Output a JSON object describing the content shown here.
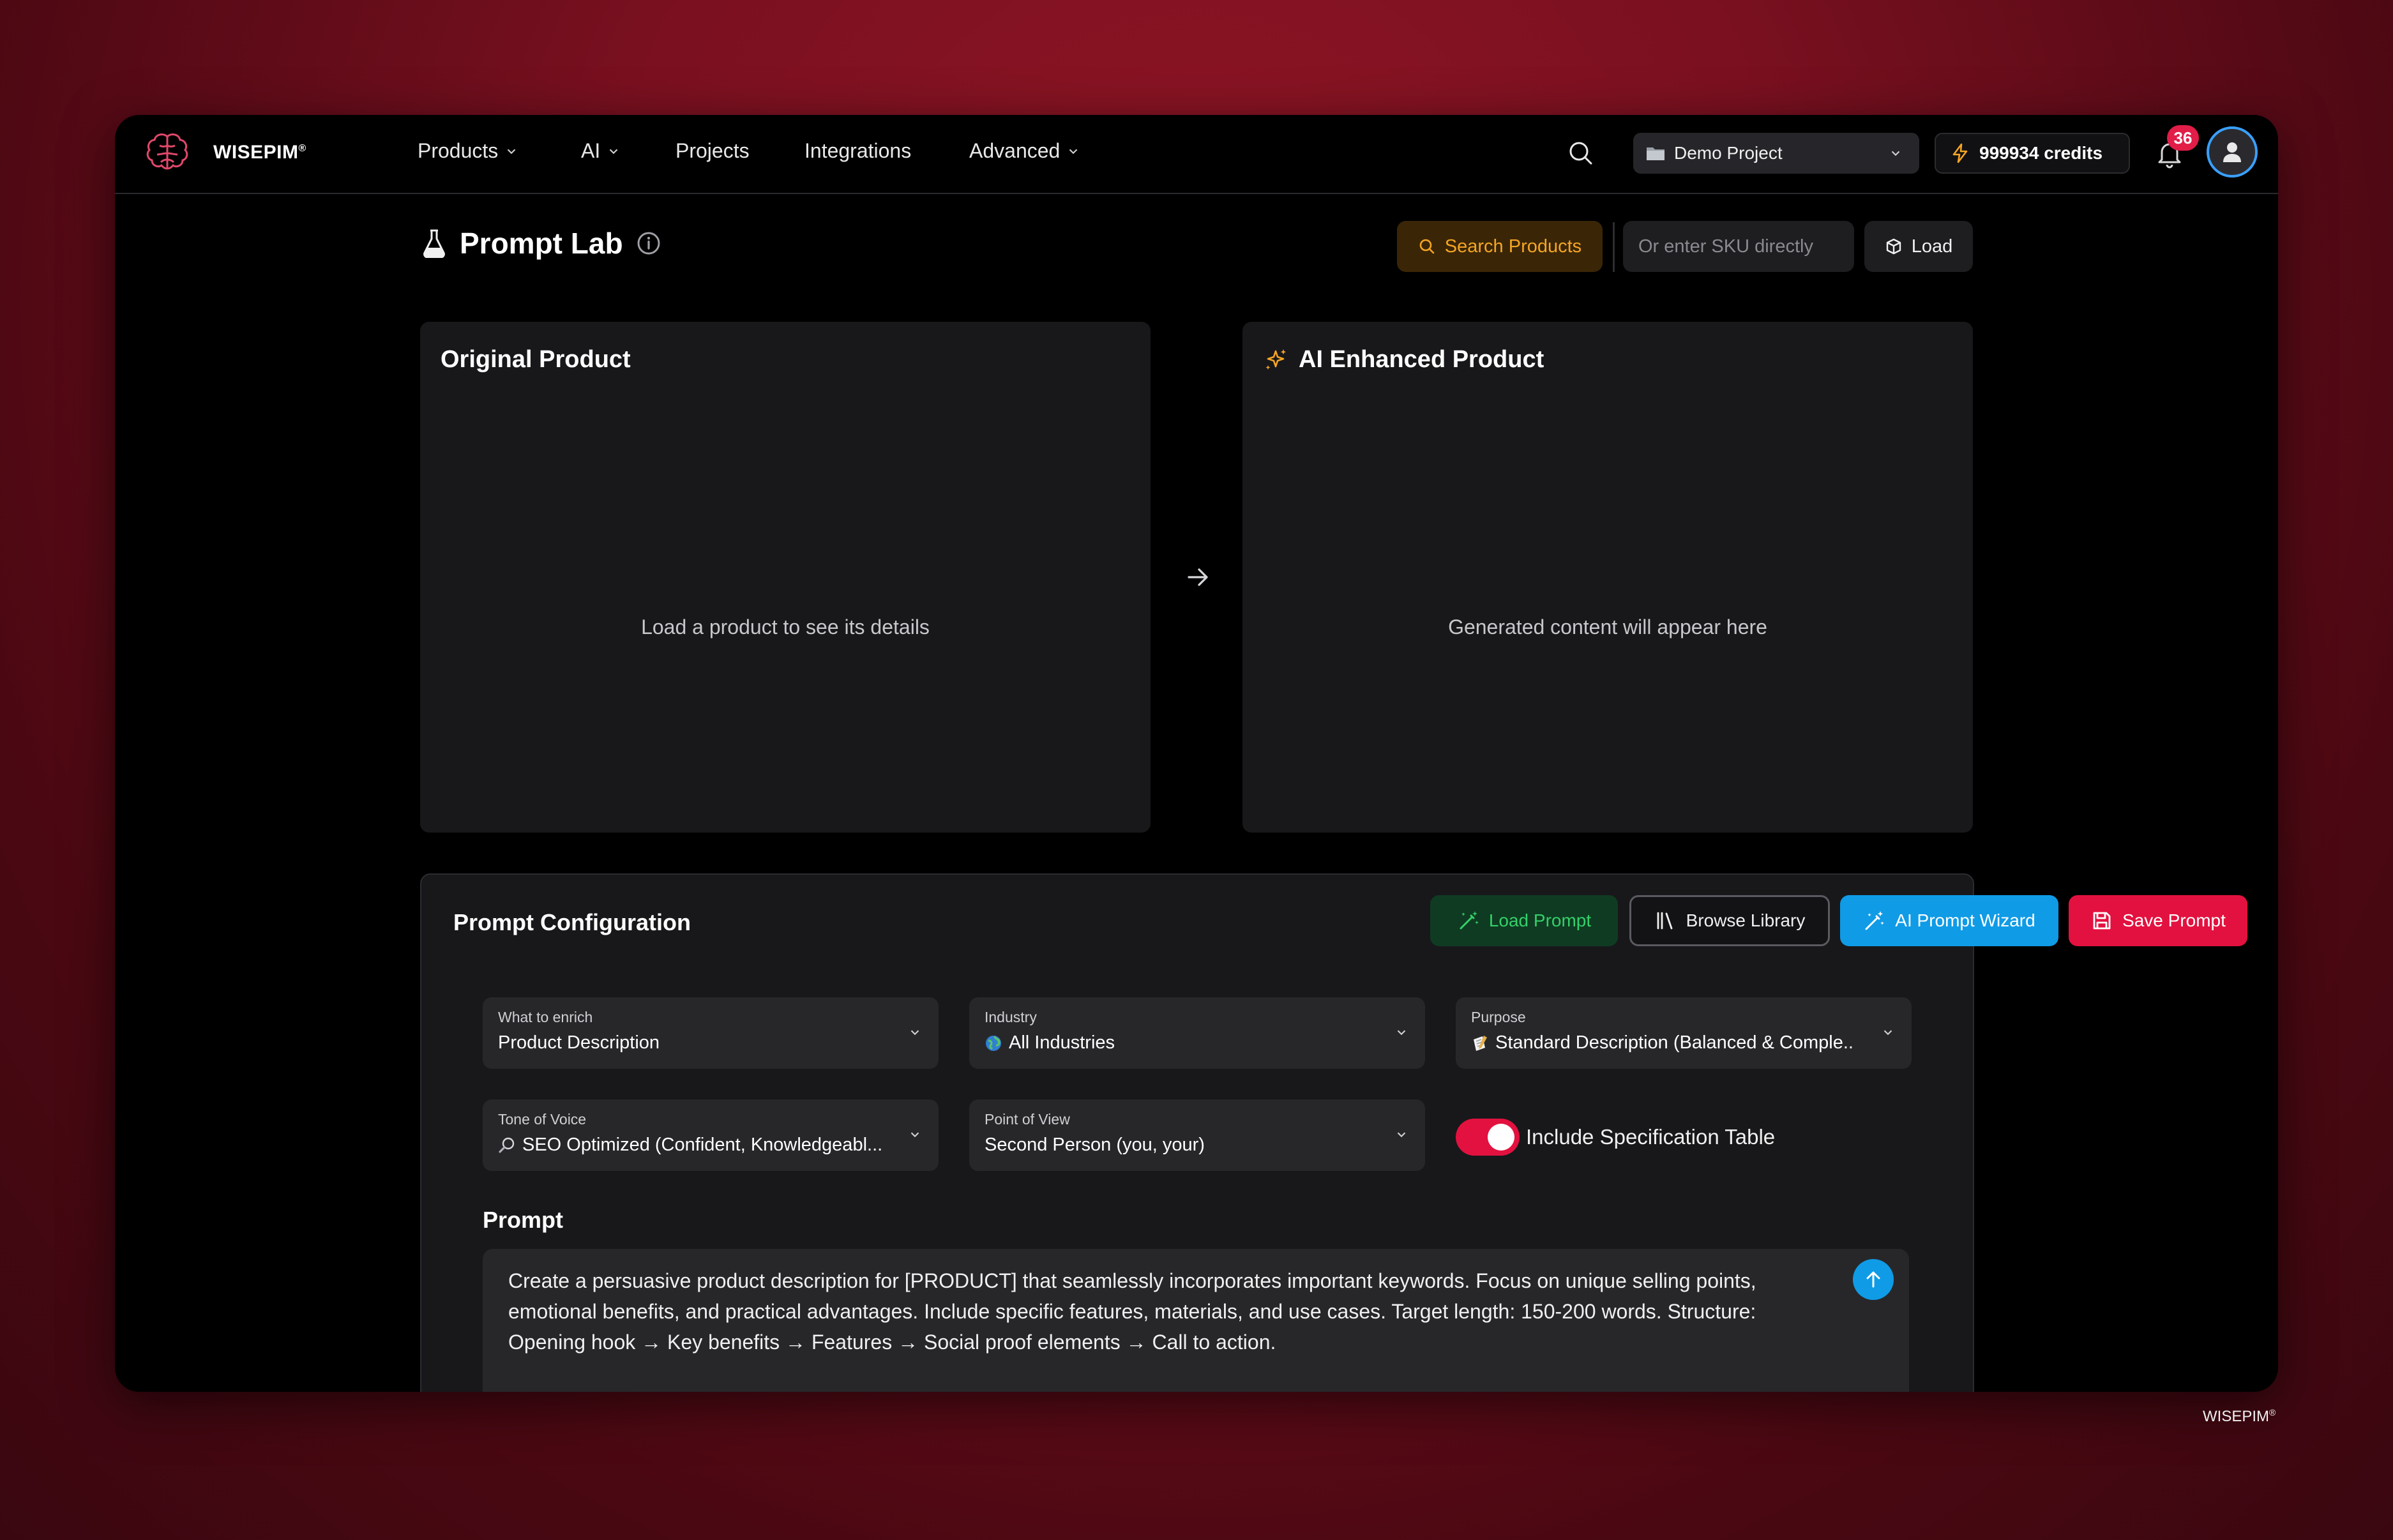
{
  "brand": {
    "name": "WISEPIM",
    "mark": "®"
  },
  "nav": {
    "items": [
      {
        "label": "Products",
        "has_dropdown": true
      },
      {
        "label": "AI",
        "has_dropdown": true
      },
      {
        "label": "Projects",
        "has_dropdown": false
      },
      {
        "label": "Integrations",
        "has_dropdown": false
      },
      {
        "label": "Advanced",
        "has_dropdown": true
      }
    ],
    "project": "Demo Project",
    "credits": "999934 credits",
    "notifications": "36"
  },
  "header": {
    "title": "Prompt Lab",
    "search_products": "Search Products",
    "sku_placeholder": "Or enter SKU directly",
    "load": "Load"
  },
  "cards": {
    "original": {
      "title": "Original Product",
      "empty": "Load a product to see its details"
    },
    "enhanced": {
      "title": "AI Enhanced Product",
      "empty": "Generated content will appear here"
    }
  },
  "config": {
    "title": "Prompt Configuration",
    "buttons": {
      "load_prompt": "Load Prompt",
      "browse_library": "Browse Library",
      "ai_wizard": "AI Prompt Wizard",
      "save_prompt": "Save Prompt"
    },
    "fields": {
      "what": {
        "label": "What to enrich",
        "value": "Product Description"
      },
      "industry": {
        "label": "Industry",
        "value": "All Industries",
        "icon": "globe-emoji-icon"
      },
      "purpose": {
        "label": "Purpose",
        "value": "Standard Description (Balanced & Comple...",
        "icon": "memo-emoji-icon"
      },
      "tone": {
        "label": "Tone of Voice",
        "value": "SEO Optimized (Confident, Knowledgeabl...",
        "icon": "magnifier-emoji-icon"
      },
      "pov": {
        "label": "Point of View",
        "value": "Second Person (you, your)"
      }
    },
    "spec_table": {
      "label": "Include Specification Table",
      "enabled": true
    },
    "prompt_label": "Prompt",
    "prompt_text": "Create a persuasive product description for [PRODUCT] that seamlessly incorporates important keywords. Focus on unique selling points, emotional benefits, and practical advantages. Include specific features, materials, and use cases. Target length: 150-200 words. Structure: Opening hook → Key benefits → Features → Social proof elements → Call to action."
  },
  "footer": {
    "brand": "WISEPIM",
    "mark": "®"
  },
  "colors": {
    "accent_red": "#e3113f",
    "accent_blue": "#0f9be6",
    "accent_green": "#34d06a",
    "accent_amber": "#f5a524",
    "card_bg": "#18181b",
    "field_bg": "#27272a"
  }
}
